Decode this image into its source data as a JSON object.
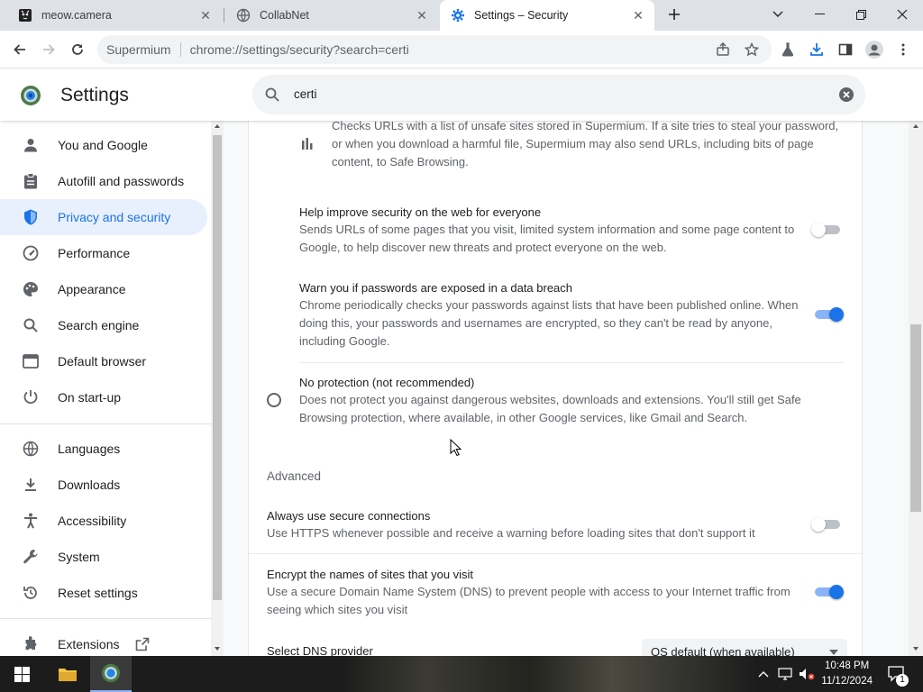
{
  "tabs": [
    {
      "title": "meow.camera",
      "icon": "camera-favicon"
    },
    {
      "title": "CollabNet",
      "icon": "globe-icon"
    },
    {
      "title": "Settings – Security",
      "icon": "gear-icon"
    }
  ],
  "omnibox": {
    "brand": "Supermium",
    "url": "chrome://settings/security?search=certi"
  },
  "settings": {
    "title": "Settings",
    "search_value": "certi"
  },
  "sidebar": {
    "items": [
      {
        "label": "You and Google",
        "icon": "person-icon"
      },
      {
        "label": "Autofill and passwords",
        "icon": "clipboard-icon"
      },
      {
        "label": "Privacy and security",
        "icon": "shield-icon",
        "selected": true
      },
      {
        "label": "Performance",
        "icon": "speedometer-icon"
      },
      {
        "label": "Appearance",
        "icon": "palette-icon"
      },
      {
        "label": "Search engine",
        "icon": "search-icon"
      },
      {
        "label": "Default browser",
        "icon": "browser-icon"
      },
      {
        "label": "On start-up",
        "icon": "power-icon"
      },
      {
        "label": "Languages",
        "icon": "globe-icon"
      },
      {
        "label": "Downloads",
        "icon": "download-icon"
      },
      {
        "label": "Accessibility",
        "icon": "accessibility-icon"
      },
      {
        "label": "System",
        "icon": "wrench-icon"
      },
      {
        "label": "Reset settings",
        "icon": "reset-icon"
      },
      {
        "label": "Extensions",
        "icon": "puzzle-icon"
      }
    ]
  },
  "main": {
    "top_desc": "Checks URLs with a list of unsafe sites stored in Supermium. If a site tries to steal your password, or when you download a harmful file, Supermium may also send URLs, including bits of page content, to Safe Browsing.",
    "help_improve": {
      "title": "Help improve security on the web for everyone",
      "desc": "Sends URLs of some pages that you visit, limited system information and some page content to Google, to help discover new threats and protect everyone on the web.",
      "enabled": false
    },
    "password_breach": {
      "title": "Warn you if passwords are exposed in a data breach",
      "desc": "Chrome periodically checks your passwords against lists that have been published online. When doing this, your passwords and usernames are encrypted, so they can't be read by anyone, including Google.",
      "enabled": true
    },
    "no_protection": {
      "title": "No protection (not recommended)",
      "desc": "Does not protect you against dangerous websites, downloads and extensions. You'll still get Safe Browsing protection, where available, in other Google services, like Gmail and Search."
    },
    "advanced_heading": "Advanced",
    "secure_connections": {
      "title": "Always use secure connections",
      "desc": "Use HTTPS whenever possible and receive a warning before loading sites that don't support it",
      "enabled": false
    },
    "encrypt_dns": {
      "title": "Encrypt the names of sites that you visit",
      "desc": "Use a secure Domain Name System (DNS) to prevent people with access to your Internet traffic from seeing which sites you visit",
      "enabled": true
    },
    "dns_provider": {
      "label": "Select DNS provider",
      "value": "OS default (when available)"
    }
  },
  "taskbar": {
    "time": "10:48 PM",
    "date": "11/12/2024",
    "notification_count": "1"
  },
  "colors": {
    "accent": "#1a73e8",
    "selected_bg": "#e8f0fe"
  }
}
